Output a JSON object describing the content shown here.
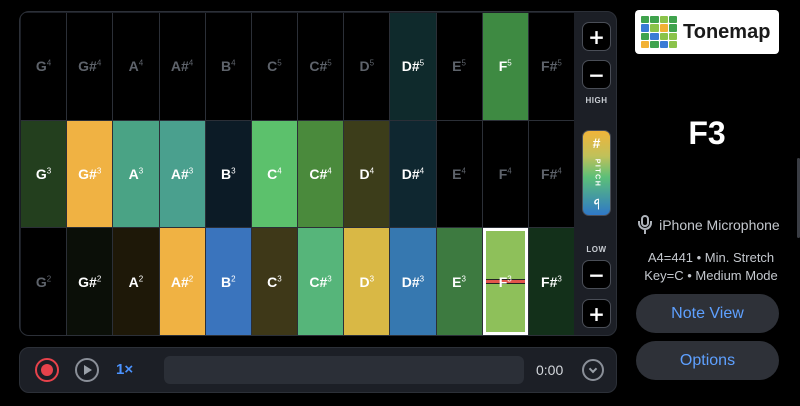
{
  "app": {
    "logo_text": "Tonemap"
  },
  "logo_colors": [
    "#3fa34d",
    "#3fa34d",
    "#8bc34a",
    "#3fa34d",
    "#3a7bd5",
    "#8bc34a",
    "#f2b134",
    "#3fa34d",
    "#3fa34d",
    "#3a7bd5",
    "#8bc34a",
    "#8bc34a",
    "#f2b134",
    "#3fa34d",
    "#3a7bd5",
    "#8bc34a"
  ],
  "grid": {
    "rows": [
      [
        {
          "n": "G",
          "o": "4",
          "bg": "#000000",
          "fg": "#5e636b"
        },
        {
          "n": "G#",
          "o": "4",
          "bg": "#000000",
          "fg": "#5e636b"
        },
        {
          "n": "A",
          "o": "4",
          "bg": "#000000",
          "fg": "#5e636b"
        },
        {
          "n": "A#",
          "o": "4",
          "bg": "#000000",
          "fg": "#5e636b"
        },
        {
          "n": "B",
          "o": "4",
          "bg": "#000000",
          "fg": "#5e636b"
        },
        {
          "n": "C",
          "o": "5",
          "bg": "#000000",
          "fg": "#5e636b"
        },
        {
          "n": "C#",
          "o": "5",
          "bg": "#000000",
          "fg": "#5e636b"
        },
        {
          "n": "D",
          "o": "5",
          "bg": "#000000",
          "fg": "#5e636b"
        },
        {
          "n": "D#",
          "o": "5",
          "bg": "#0f2a2c",
          "fg": "#ffffff"
        },
        {
          "n": "E",
          "o": "5",
          "bg": "#000000",
          "fg": "#5e636b"
        },
        {
          "n": "F",
          "o": "5",
          "bg": "#3e8a42",
          "fg": "#ffffff"
        },
        {
          "n": "F#",
          "o": "5",
          "bg": "#000000",
          "fg": "#5e636b"
        }
      ],
      [
        {
          "n": "G",
          "o": "3",
          "bg": "#233f1e",
          "fg": "#ffffff"
        },
        {
          "n": "G#",
          "o": "3",
          "bg": "#f0b243",
          "fg": "#ffffff"
        },
        {
          "n": "A",
          "o": "3",
          "bg": "#4aa385",
          "fg": "#ffffff"
        },
        {
          "n": "A#",
          "o": "3",
          "bg": "#4aa08e",
          "fg": "#ffffff"
        },
        {
          "n": "B",
          "o": "3",
          "bg": "#0c1b26",
          "fg": "#ffffff"
        },
        {
          "n": "C",
          "o": "4",
          "bg": "#5cc16c",
          "fg": "#ffffff"
        },
        {
          "n": "C#",
          "o": "4",
          "bg": "#4a8a3c",
          "fg": "#ffffff"
        },
        {
          "n": "D",
          "o": "4",
          "bg": "#3c3d1a",
          "fg": "#ffffff"
        },
        {
          "n": "D#",
          "o": "4",
          "bg": "#0f2730",
          "fg": "#ffffff"
        },
        {
          "n": "E",
          "o": "4",
          "bg": "#000000",
          "fg": "#5e636b"
        },
        {
          "n": "F",
          "o": "4",
          "bg": "#000000",
          "fg": "#5e636b"
        },
        {
          "n": "F#",
          "o": "4",
          "bg": "#000000",
          "fg": "#5e636b"
        }
      ],
      [
        {
          "n": "G",
          "o": "2",
          "bg": "#000000",
          "fg": "#5e636b"
        },
        {
          "n": "G#",
          "o": "2",
          "bg": "#0b0f08",
          "fg": "#ffffff"
        },
        {
          "n": "A",
          "o": "2",
          "bg": "#1e1808",
          "fg": "#ffffff"
        },
        {
          "n": "A#",
          "o": "2",
          "bg": "#f0b243",
          "fg": "#ffffff"
        },
        {
          "n": "B",
          "o": "2",
          "bg": "#3a74bd",
          "fg": "#ffffff"
        },
        {
          "n": "C",
          "o": "3",
          "bg": "#3e3818",
          "fg": "#ffffff"
        },
        {
          "n": "C#",
          "o": "3",
          "bg": "#56b57a",
          "fg": "#ffffff"
        },
        {
          "n": "D",
          "o": "3",
          "bg": "#d9b845",
          "fg": "#ffffff"
        },
        {
          "n": "D#",
          "o": "3",
          "bg": "#3678b0",
          "fg": "#ffffff"
        },
        {
          "n": "E",
          "o": "3",
          "bg": "#3d7a40",
          "fg": "#ffffff"
        },
        {
          "n": "F",
          "o": "3",
          "bg": "#8ec05a",
          "fg": "#ffffff",
          "active": true
        },
        {
          "n": "F#",
          "o": "3",
          "bg": "#13301a",
          "fg": "#ffffff"
        }
      ]
    ]
  },
  "side": {
    "plus_label": "+",
    "minus_label": "−",
    "high_label": "HIGH",
    "low_label": "LOW",
    "pitch_word": "PITCH",
    "sharp_symbol": "#",
    "flat_symbol": "♭"
  },
  "transport": {
    "speed_label": "1×",
    "time": "0:00"
  },
  "panel": {
    "current_note": "F3",
    "mic_name": "iPhone Microphone",
    "settings_line1": "A4=441 • Min. Stretch",
    "settings_line2": "Key=C • Medium Mode",
    "note_view_label": "Note View",
    "options_label": "Options"
  },
  "colors": {
    "accent": "#5ea0ff",
    "record": "#e7424b"
  }
}
